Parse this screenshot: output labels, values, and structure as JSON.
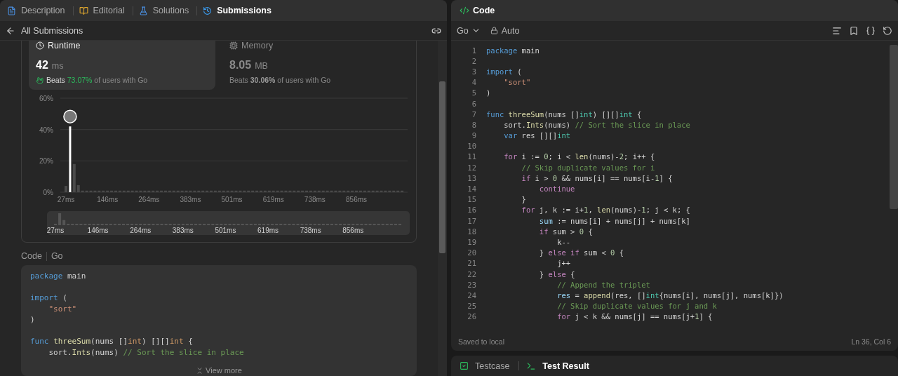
{
  "left_panel": {
    "tabs": [
      {
        "label": "Description",
        "selected": false
      },
      {
        "label": "Editorial",
        "selected": false
      },
      {
        "label": "Solutions",
        "selected": false
      },
      {
        "label": "Submissions",
        "selected": true
      }
    ],
    "back_label": "All Submissions",
    "metrics": [
      {
        "kind": "runtime",
        "label": "Runtime",
        "value": "42",
        "unit": "ms",
        "beats": "Beats",
        "percent": "73.07%",
        "suffix": "of users with Go",
        "selected": true
      },
      {
        "kind": "memory",
        "label": "Memory",
        "value": "8.05",
        "unit": "MB",
        "beats": "Beats",
        "percent": "30.06%",
        "suffix": "of users with Go",
        "selected": false
      }
    ],
    "chart_data": {
      "type": "bar",
      "stacked": true,
      "ylim": [
        0,
        60
      ],
      "yticks": [
        {
          "value": 0,
          "label": "0%"
        },
        {
          "value": 20,
          "label": "20%"
        },
        {
          "value": 40,
          "label": "40%"
        },
        {
          "value": 60,
          "label": "60%"
        }
      ],
      "categories": [
        "27ms",
        null,
        null,
        null,
        null,
        null,
        null,
        null,
        null,
        null,
        "146ms",
        null,
        null,
        null,
        null,
        null,
        null,
        null,
        null,
        null,
        "264ms",
        null,
        null,
        null,
        null,
        null,
        null,
        null,
        null,
        null,
        "383ms",
        null,
        null,
        null,
        null,
        null,
        null,
        null,
        null,
        null,
        "501ms",
        null,
        null,
        null,
        null,
        null,
        null,
        null,
        null,
        null,
        "619ms",
        null,
        null,
        null,
        null,
        null,
        null,
        null,
        null,
        null,
        "738ms",
        null,
        null,
        null,
        null,
        null,
        null,
        null,
        null,
        null,
        "856ms",
        null,
        null,
        null,
        null,
        null,
        null,
        null,
        null,
        null,
        null,
        null
      ],
      "series": [
        {
          "color": "#4a4a4a",
          "values": [
            4,
            null,
            18,
            4.5,
            1,
            1,
            1,
            1,
            1,
            1,
            1,
            1,
            1,
            1,
            1,
            1,
            1,
            1,
            1,
            1,
            1,
            1,
            1,
            1,
            1,
            1,
            1,
            1,
            1,
            1,
            1,
            1,
            1,
            1,
            1,
            1,
            1,
            1,
            1,
            1,
            1,
            1,
            1,
            1,
            1,
            1,
            1,
            1,
            1,
            1,
            1,
            1,
            1,
            1,
            1,
            1,
            1,
            1,
            1,
            1,
            1,
            1,
            1,
            1,
            1,
            1,
            1,
            1,
            1,
            1,
            1,
            1,
            1,
            1,
            1,
            1,
            1,
            1,
            1,
            1,
            1,
            1
          ]
        },
        {
          "color": "#ffffff",
          "values": [
            null,
            42,
            null,
            null,
            null,
            null,
            null,
            null,
            null,
            null,
            null,
            null,
            null,
            null,
            null,
            null,
            null,
            null,
            null,
            null,
            null,
            null,
            null,
            null,
            null,
            null,
            null,
            null,
            null,
            null,
            null,
            null,
            null,
            null,
            null,
            null,
            null,
            null,
            null,
            null,
            null,
            null,
            null,
            null,
            null,
            null,
            null,
            null,
            null,
            null,
            null,
            null,
            null,
            null,
            null,
            null,
            null,
            null,
            null,
            null,
            null,
            null,
            null,
            null,
            null,
            null,
            null,
            null,
            null,
            null,
            null,
            null,
            null,
            null,
            null,
            null,
            null,
            null,
            null,
            null,
            null,
            null
          ]
        }
      ]
    },
    "brush_labels": [
      "27ms",
      "146ms",
      "264ms",
      "383ms",
      "501ms",
      "619ms",
      "738ms",
      "856ms"
    ],
    "code_header": [
      "Code",
      "Go"
    ],
    "code": [
      {
        "space_before": false,
        "tokens": [
          {
            "kind": "kw",
            "text": "package"
          },
          {
            "kind": "p",
            "text": " main"
          }
        ]
      },
      {
        "space_before": true,
        "tokens": [
          {
            "kind": "kw",
            "text": "import"
          },
          {
            "kind": "p",
            "text": " ("
          }
        ]
      },
      {
        "space_before": false,
        "tokens": [
          {
            "kind": "st",
            "text": "    \"sort\""
          }
        ]
      },
      {
        "space_before": false,
        "tokens": [
          {
            "kind": "p",
            "text": ")"
          }
        ]
      },
      {
        "space_before": true,
        "tokens": [
          {
            "kind": "kw",
            "text": "func "
          },
          {
            "kind": "fn",
            "text": "threeSum"
          },
          {
            "kind": "p",
            "text": "(nums []"
          },
          {
            "kind": "ty",
            "text": "int"
          },
          {
            "kind": "p",
            "text": ") [][]"
          },
          {
            "kind": "ty",
            "text": "int"
          },
          {
            "kind": "p",
            "text": " {"
          }
        ]
      },
      {
        "space_before": false,
        "tokens": [
          {
            "kind": "p",
            "text": "    sort."
          },
          {
            "kind": "fn",
            "text": "Ints"
          },
          {
            "kind": "p",
            "text": "(nums) "
          },
          {
            "kind": "cm",
            "text": "// Sort the slice in place"
          }
        ]
      }
    ],
    "view_more": "View more"
  },
  "right_panel": {
    "title": "Code",
    "language": "Go",
    "mode": "Auto",
    "lines": [
      {
        "n": "1",
        "code": [
          {
            "kind": "kw",
            "text": "package"
          },
          {
            "kind": "p",
            "text": " main"
          }
        ]
      },
      {
        "n": "2"
      },
      {
        "n": "3",
        "code": [
          {
            "kind": "kw",
            "text": "import"
          },
          {
            "kind": "p",
            "text": " ("
          }
        ]
      },
      {
        "n": "4",
        "code": [
          {
            "kind": "st",
            "text": "    \"sort\""
          }
        ]
      },
      {
        "n": "5",
        "code": [
          {
            "kind": "p",
            "text": ")"
          }
        ]
      },
      {
        "n": "6"
      },
      {
        "n": "7",
        "code": [
          {
            "kind": "kw",
            "text": "func "
          },
          {
            "kind": "fn",
            "text": "threeSum"
          },
          {
            "kind": "p",
            "text": "(nums []"
          },
          {
            "kind": "ty",
            "text": "int"
          },
          {
            "kind": "p",
            "text": ") [][]"
          },
          {
            "kind": "ty",
            "text": "int"
          },
          {
            "kind": "p",
            "text": " {"
          }
        ]
      },
      {
        "n": "8",
        "code": [
          {
            "kind": "p",
            "text": "    sort."
          },
          {
            "kind": "fn",
            "text": "Ints"
          },
          {
            "kind": "p",
            "text": "(nums) "
          },
          {
            "kind": "cm",
            "text": "// Sort the slice in place"
          }
        ]
      },
      {
        "n": "9",
        "code": [
          {
            "kind": "kw",
            "text": "    var"
          },
          {
            "kind": "p",
            "text": " res [][]"
          },
          {
            "kind": "ty",
            "text": "int"
          }
        ]
      },
      {
        "n": "10"
      },
      {
        "n": "11",
        "code": [
          {
            "kind": "ct",
            "text": "    for"
          },
          {
            "kind": "p",
            "text": " i := "
          },
          {
            "kind": "nu",
            "text": "0"
          },
          {
            "kind": "p",
            "text": "; i < "
          },
          {
            "kind": "fn",
            "text": "len"
          },
          {
            "kind": "p",
            "text": "(nums)-"
          },
          {
            "kind": "nu",
            "text": "2"
          },
          {
            "kind": "p",
            "text": "; i++ {"
          }
        ]
      },
      {
        "n": "12",
        "code": [
          {
            "kind": "cm",
            "text": "        // Skip duplicate values for i"
          }
        ]
      },
      {
        "n": "13",
        "code": [
          {
            "kind": "ct",
            "text": "        if"
          },
          {
            "kind": "p",
            "text": " i > "
          },
          {
            "kind": "nu",
            "text": "0"
          },
          {
            "kind": "p",
            "text": " && nums[i] == nums[i-"
          },
          {
            "kind": "nu",
            "text": "1"
          },
          {
            "kind": "p",
            "text": "] {"
          }
        ]
      },
      {
        "n": "14",
        "code": [
          {
            "kind": "ct",
            "text": "            continue"
          }
        ]
      },
      {
        "n": "15",
        "code": [
          {
            "kind": "p",
            "text": "        }"
          }
        ]
      },
      {
        "n": "16",
        "code": [
          {
            "kind": "ct",
            "text": "        for"
          },
          {
            "kind": "p",
            "text": " j, k := i+"
          },
          {
            "kind": "nu",
            "text": "1"
          },
          {
            "kind": "p",
            "text": ", "
          },
          {
            "kind": "fn",
            "text": "len"
          },
          {
            "kind": "p",
            "text": "(nums)-"
          },
          {
            "kind": "nu",
            "text": "1"
          },
          {
            "kind": "p",
            "text": "; j < k; {"
          }
        ]
      },
      {
        "n": "17",
        "code": [
          {
            "kind": "va",
            "text": "            sum"
          },
          {
            "kind": "p",
            "text": " := nums[i] + nums[j] + nums[k]"
          }
        ]
      },
      {
        "n": "18",
        "code": [
          {
            "kind": "ct",
            "text": "            if"
          },
          {
            "kind": "p",
            "text": " sum > "
          },
          {
            "kind": "nu",
            "text": "0"
          },
          {
            "kind": "p",
            "text": " {"
          }
        ]
      },
      {
        "n": "19",
        "code": [
          {
            "kind": "p",
            "text": "                k--"
          }
        ]
      },
      {
        "n": "20",
        "code": [
          {
            "kind": "p",
            "text": "            } "
          },
          {
            "kind": "ct",
            "text": "else if"
          },
          {
            "kind": "p",
            "text": " sum < "
          },
          {
            "kind": "nu",
            "text": "0"
          },
          {
            "kind": "p",
            "text": " {"
          }
        ]
      },
      {
        "n": "21",
        "code": [
          {
            "kind": "p",
            "text": "                j++"
          }
        ]
      },
      {
        "n": "22",
        "code": [
          {
            "kind": "p",
            "text": "            } "
          },
          {
            "kind": "ct",
            "text": "else"
          },
          {
            "kind": "p",
            "text": " {"
          }
        ]
      },
      {
        "n": "23",
        "code": [
          {
            "kind": "cm",
            "text": "                // Append the triplet"
          }
        ]
      },
      {
        "n": "24",
        "code": [
          {
            "kind": "va",
            "text": "                res"
          },
          {
            "kind": "p",
            "text": " = "
          },
          {
            "kind": "fn",
            "text": "append"
          },
          {
            "kind": "p",
            "text": "(res, []"
          },
          {
            "kind": "ty",
            "text": "int"
          },
          {
            "kind": "p",
            "text": "{nums[i], nums[j], nums[k]})"
          }
        ]
      },
      {
        "n": "25",
        "code": [
          {
            "kind": "cm",
            "text": "                // Skip duplicate values for j and k"
          }
        ]
      },
      {
        "n": "26",
        "code": [
          {
            "kind": "ct",
            "text": "                for"
          },
          {
            "kind": "p",
            "text": " j < k && nums[j] == nums[j+"
          },
          {
            "kind": "nu",
            "text": "1"
          },
          {
            "kind": "p",
            "text": "] {"
          }
        ]
      }
    ],
    "status": "Saved to local",
    "cursor": "Ln 36, Col 6",
    "bottom_tabs": [
      {
        "label": "Testcase",
        "selected": false
      },
      {
        "label": "Test Result",
        "selected": true
      }
    ]
  }
}
